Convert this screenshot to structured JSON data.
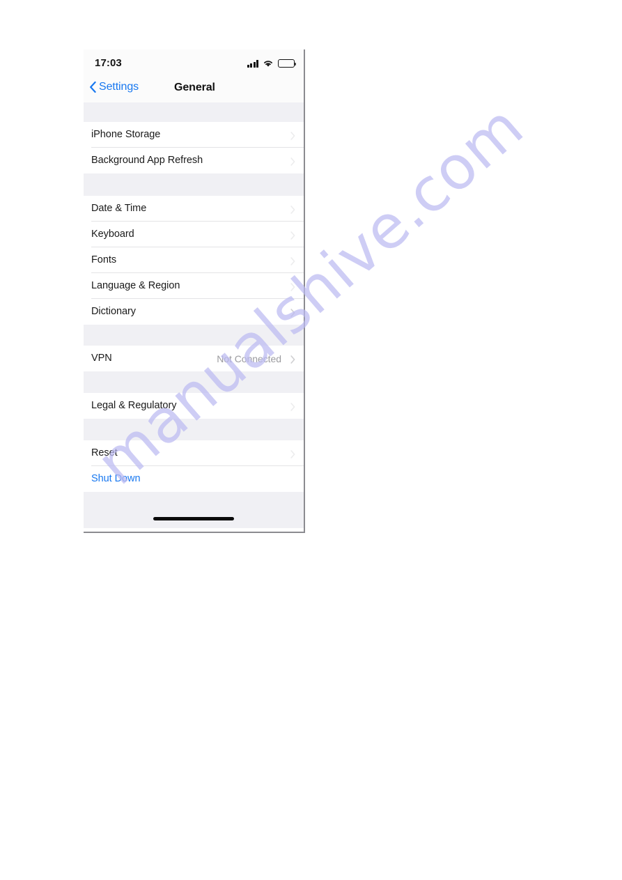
{
  "page": {
    "background": "#ffffff",
    "watermark": "manualshive.com",
    "watermark_color": "#bcbbf2"
  },
  "phone": {
    "status_bar": {
      "time": "17:03",
      "cellular_icon": "cellular-bars-icon",
      "wifi_icon": "wifi-icon",
      "battery_icon": "battery-full-icon"
    },
    "nav_bar": {
      "back_icon": "chevron-left-icon",
      "back_label": "Settings",
      "title": "General",
      "accent": "#1878f0"
    },
    "sections": [
      {
        "id": "storage",
        "rows": [
          {
            "label": "iPhone Storage",
            "value": "",
            "accessory": "chevron-right-icon",
            "style": "default"
          },
          {
            "label": "Background App Refresh",
            "value": "",
            "accessory": "chevron-right-icon",
            "style": "default"
          }
        ]
      },
      {
        "id": "international",
        "rows": [
          {
            "label": "Date & Time",
            "value": "",
            "accessory": "chevron-right-icon",
            "style": "default"
          },
          {
            "label": "Keyboard",
            "value": "",
            "accessory": "chevron-right-icon",
            "style": "default"
          },
          {
            "label": "Fonts",
            "value": "",
            "accessory": "chevron-right-icon",
            "style": "default"
          },
          {
            "label": "Language & Region",
            "value": "",
            "accessory": "chevron-right-icon",
            "style": "default"
          },
          {
            "label": "Dictionary",
            "value": "",
            "accessory": "chevron-right-icon",
            "style": "default"
          }
        ]
      },
      {
        "id": "vpn",
        "rows": [
          {
            "label": "VPN",
            "value": "Not Connected",
            "accessory": "chevron-right-icon",
            "style": "default"
          }
        ]
      },
      {
        "id": "legal",
        "rows": [
          {
            "label": "Legal & Regulatory",
            "value": "",
            "accessory": "chevron-right-icon",
            "style": "default"
          }
        ]
      },
      {
        "id": "reset",
        "rows": [
          {
            "label": "Reset",
            "value": "",
            "accessory": "chevron-right-icon",
            "style": "default"
          },
          {
            "label": "Shut Down",
            "value": "",
            "accessory": "",
            "style": "blue"
          }
        ]
      }
    ],
    "home_indicator": "home-indicator"
  }
}
